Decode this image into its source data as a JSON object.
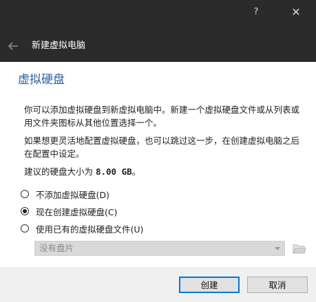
{
  "window": {
    "help_glyph": "?",
    "close_glyph": "✕",
    "wizard_title": "新建虚拟电脑"
  },
  "page": {
    "heading": "虚拟硬盘",
    "paragraph1": "你可以添加虚拟硬盘到新虚拟电脑中。新建一个虚拟硬盘文件或从列表或用文件夹图标从其他位置选择一个。",
    "paragraph2": "如果想更灵活地配置虚拟硬盘，也可以跳过这一步，在创建虚拟电脑之后在配置中设定。",
    "size_prefix": "建议的硬盘大小为 ",
    "size_value": "8.00 GB",
    "size_suffix": "。"
  },
  "options": [
    {
      "label": "不添加虚拟硬盘(D)",
      "checked": false
    },
    {
      "label": "现在创建虚拟硬盘(C)",
      "checked": true
    },
    {
      "label": "使用已有的虚拟硬盘文件(U)",
      "checked": false
    }
  ],
  "disk_combo": {
    "value": "没有盘片",
    "enabled": false
  },
  "icons": {
    "back": "back-arrow-icon",
    "folder": "folder-open-icon"
  },
  "buttons": {
    "create": "创建",
    "cancel": "取消"
  },
  "colors": {
    "titlebar": "#2b2b2b",
    "heading": "#2f5d9e",
    "focus": "#0078d7"
  }
}
